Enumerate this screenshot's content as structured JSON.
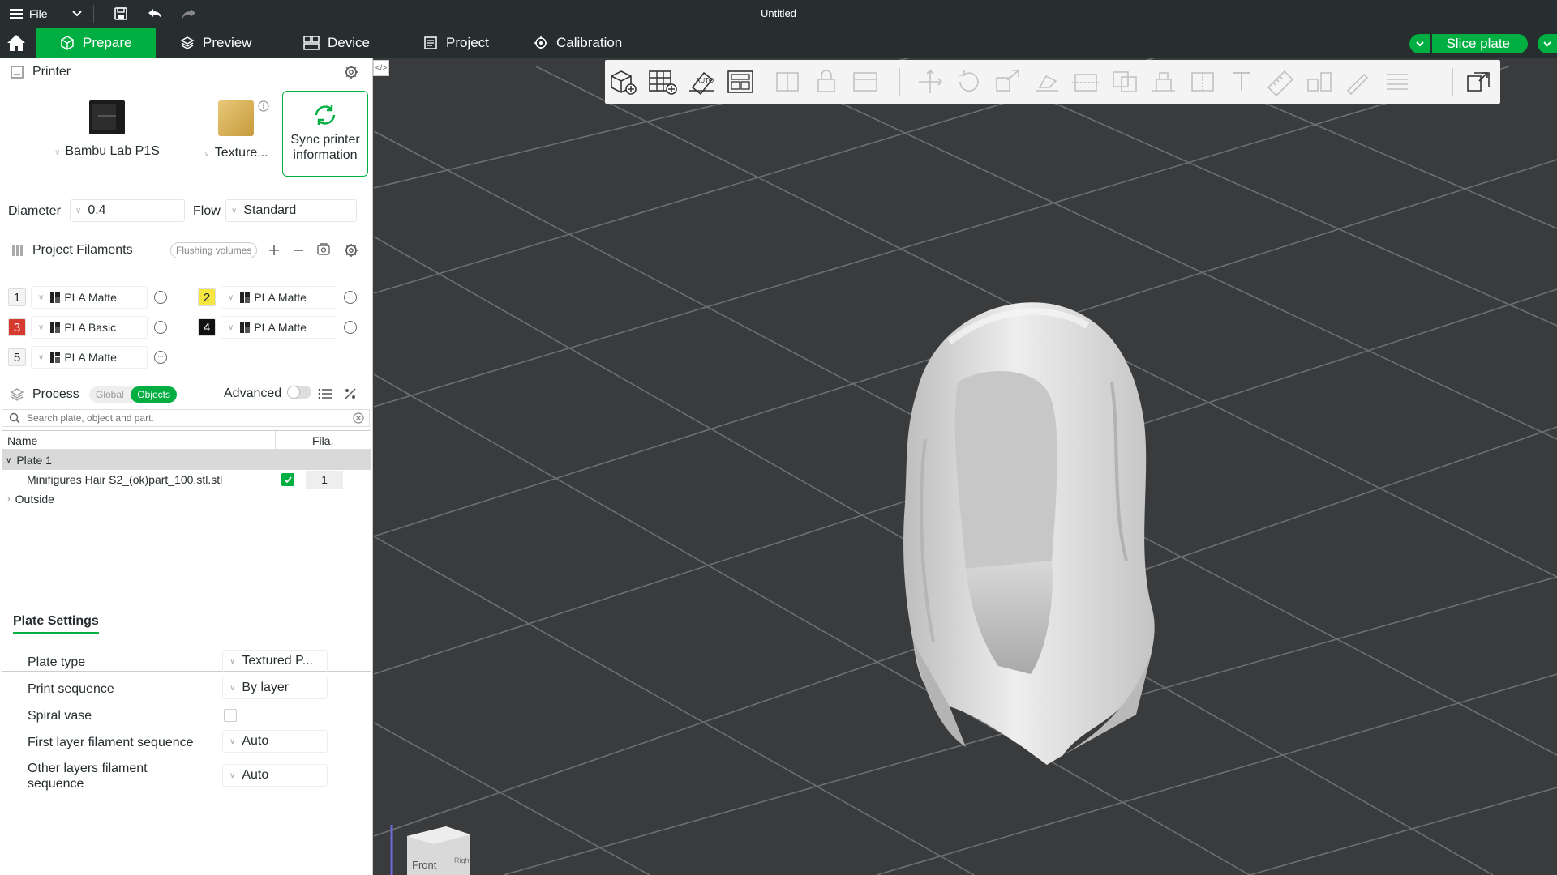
{
  "titlebar": {
    "file_label": "File",
    "window_title": "Untitled"
  },
  "nav": {
    "tabs": [
      {
        "label": "Prepare"
      },
      {
        "label": "Preview"
      },
      {
        "label": "Device"
      },
      {
        "label": "Project"
      },
      {
        "label": "Calibration"
      }
    ],
    "slice_label": "Slice plate"
  },
  "printer": {
    "section_title": "Printer",
    "printer_name": "Bambu Lab P1S",
    "plate_name": "Texture...",
    "sync_label_1": "Sync printer",
    "sync_label_2": "information",
    "diameter_label": "Diameter",
    "diameter_value": "0.4",
    "flow_label": "Flow",
    "flow_value": "Standard"
  },
  "filaments": {
    "section_title": "Project Filaments",
    "flushing_label": "Flushing volumes",
    "items": [
      {
        "num": "1",
        "name": "PLA Matte",
        "color": "#f4f4f4",
        "text_color": "#262e30"
      },
      {
        "num": "2",
        "name": "PLA Matte",
        "color": "#f5e642",
        "text_color": "#262e30"
      },
      {
        "num": "3",
        "name": "PLA Basic",
        "color": "#d63a2f",
        "text_color": "#ffffff"
      },
      {
        "num": "4",
        "name": "PLA Matte",
        "color": "#111111",
        "text_color": "#ffffff"
      },
      {
        "num": "5",
        "name": "PLA Matte",
        "color": "#f4f4f4",
        "text_color": "#262e30"
      }
    ]
  },
  "process": {
    "section_title": "Process",
    "global_label": "Global",
    "objects_label": "Objects",
    "advanced_label": "Advanced",
    "search_placeholder": "Search plate, object and part.",
    "col_name": "Name",
    "col_fila": "Fila.",
    "rows": {
      "plate": "Plate 1",
      "object_name": "Minifigures Hair S2_(ok)part_100.stl.stl",
      "object_fila": "1",
      "outside": "Outside"
    }
  },
  "plate_settings": {
    "tab_label": "Plate Settings",
    "plate_type_label": "Plate type",
    "plate_type_value": "Textured P...",
    "print_seq_label": "Print sequence",
    "print_seq_value": "By layer",
    "spiral_label": "Spiral vase",
    "spiral_checked": false,
    "first_layer_label": "First layer filament sequence",
    "first_layer_value": "Auto",
    "other_layers_label_1": "Other layers filament",
    "other_layers_label_2": "sequence",
    "other_layers_value": "Auto"
  },
  "viewport": {
    "navcube_front": "Front",
    "navcube_right": "Right"
  },
  "colors": {
    "accent": "#00ae42",
    "topbar": "#262e30",
    "viewport_bg": "#3a3b3d"
  }
}
